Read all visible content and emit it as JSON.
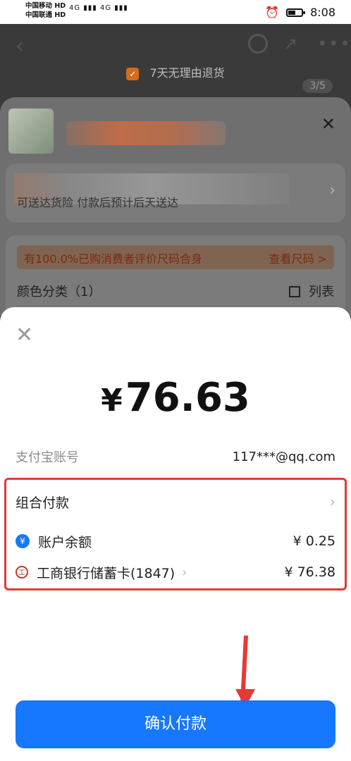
{
  "status_bar": {
    "carrier1": "中国移动",
    "carrier2": "中国联通",
    "hd": "HD",
    "signal": "4G ▮▮▮ 4G ▮▮▮",
    "time": "8:08"
  },
  "product_page": {
    "return_badge": "7天无理由退货",
    "pager": "3/5",
    "address_tip": "可送达货险 付款后预计后天送达",
    "size_tip": "有100.0%已购消费者评价尺码合身",
    "size_link": "查看尺码 >",
    "color_label": "颜色分类（1）",
    "list_toggle": "列表"
  },
  "payment": {
    "amount": "76.63",
    "currency_symbol": "¥",
    "account_label": "支付宝账号",
    "account_value": "117***@qq.com",
    "combo_title": "组合付款",
    "balance_label": "账户余额",
    "balance_amount": "¥ 0.25",
    "bank_label": "工商银行储蓄卡(1847)",
    "bank_amount": "¥ 76.38",
    "confirm_label": "确认付款"
  },
  "colors": {
    "primary_blue": "#1677ff",
    "highlight_red": "#e53935"
  }
}
